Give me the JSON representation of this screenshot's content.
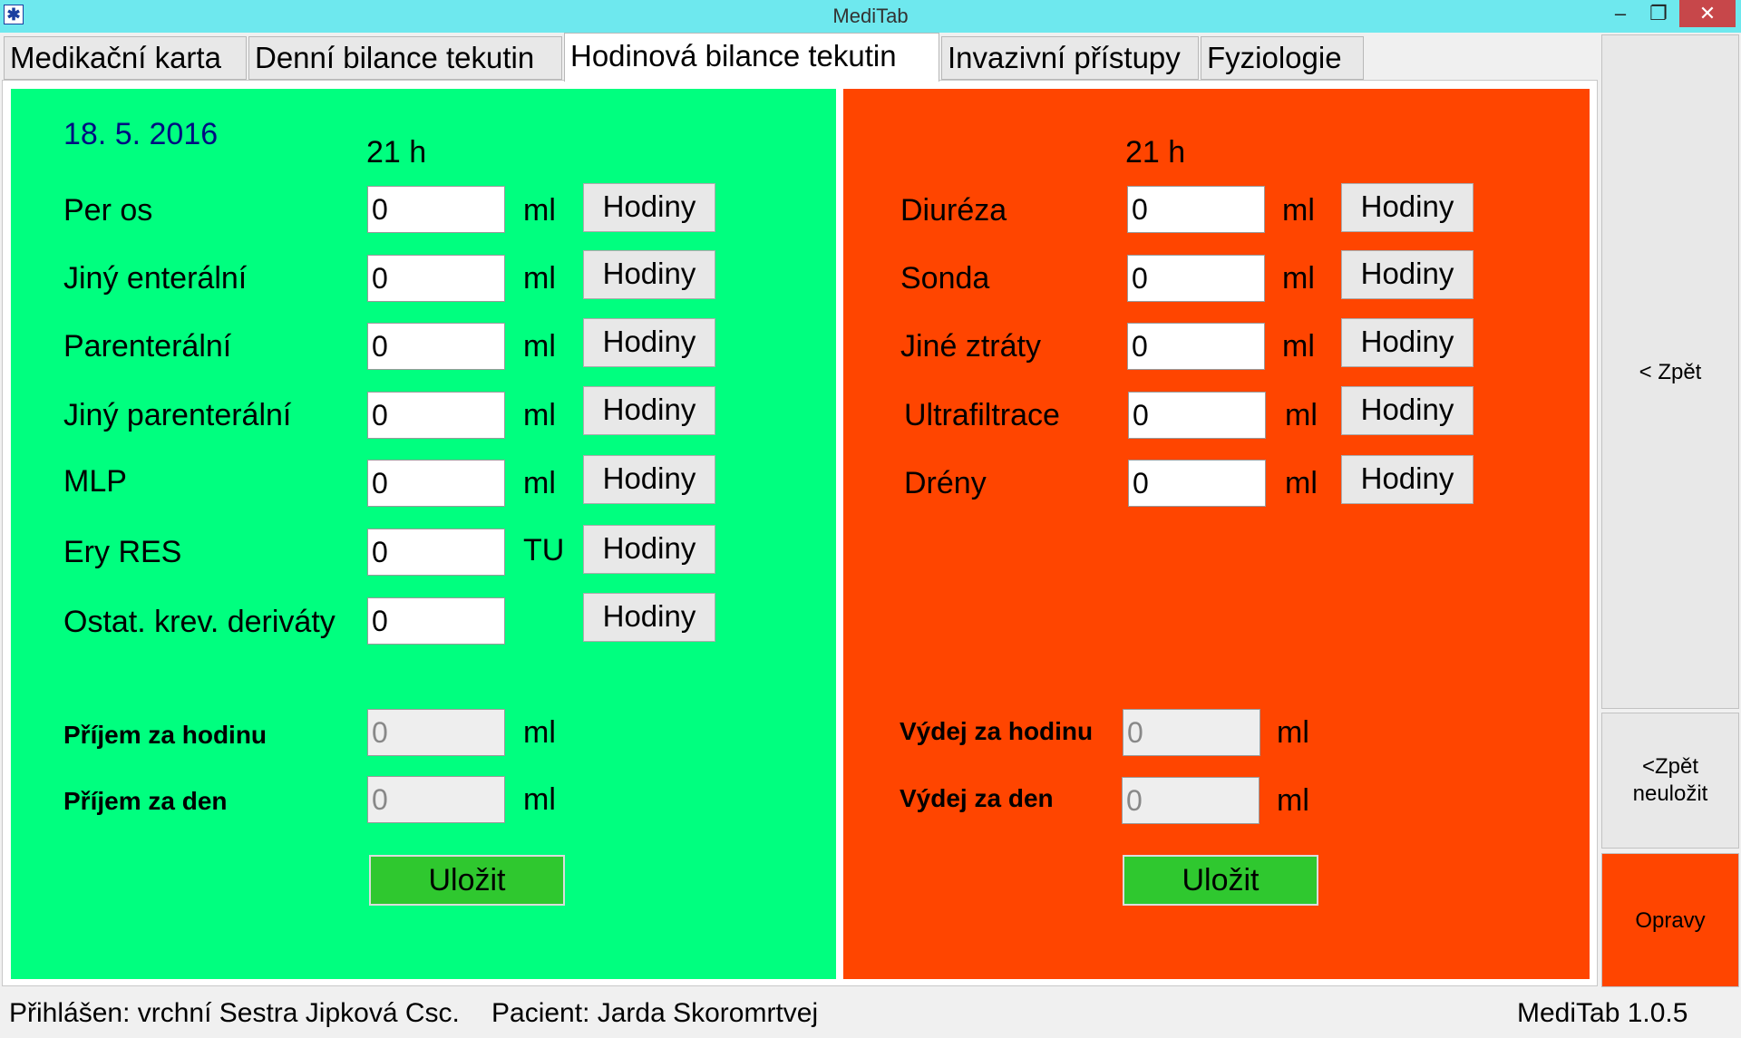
{
  "window": {
    "title": "MediTab",
    "min": "–",
    "max": "❐",
    "close": "✕"
  },
  "tabs": [
    {
      "label": "Medikační karta"
    },
    {
      "label": "Denní bilance tekutin"
    },
    {
      "label": "Hodinová bilance tekutin"
    },
    {
      "label": "Invazivní přístupy"
    },
    {
      "label": "Fyziologie"
    }
  ],
  "intake": {
    "date": "18. 5. 2016",
    "hour": "21 h",
    "rows": [
      {
        "label": "Per os",
        "value": "0",
        "unit": "ml",
        "button": "Hodiny"
      },
      {
        "label": "Jiný enterální",
        "value": "0",
        "unit": "ml",
        "button": "Hodiny"
      },
      {
        "label": "Parenterální",
        "value": "0",
        "unit": "ml",
        "button": "Hodiny"
      },
      {
        "label": "Jiný parenterální",
        "value": "0",
        "unit": "ml",
        "button": "Hodiny"
      },
      {
        "label": "MLP",
        "value": "0",
        "unit": "ml",
        "button": "Hodiny"
      },
      {
        "label": "Ery RES",
        "value": "0",
        "unit": "TU",
        "button": "Hodiny"
      },
      {
        "label": "Ostat. krev. deriváty",
        "value": "0",
        "unit": "",
        "button": "Hodiny"
      }
    ],
    "total_hour": {
      "label": "Příjem za hodinu",
      "value": "0",
      "unit": "ml"
    },
    "total_day": {
      "label": "Příjem za den",
      "value": "0",
      "unit": "ml"
    },
    "save_label": "Uložit"
  },
  "output": {
    "hour": "21 h",
    "rows": [
      {
        "label": "Diuréza",
        "value": "0",
        "unit": "ml",
        "button": "Hodiny"
      },
      {
        "label": "Sonda",
        "value": "0",
        "unit": "ml",
        "button": "Hodiny"
      },
      {
        "label": "Jiné ztráty",
        "value": "0",
        "unit": "ml",
        "button": "Hodiny"
      },
      {
        "label": "Ultrafiltrace",
        "value": "0",
        "unit": "ml",
        "button": "Hodiny"
      },
      {
        "label": "Drény",
        "value": "0",
        "unit": "ml",
        "button": "Hodiny"
      }
    ],
    "total_hour": {
      "label": "Výdej za hodinu",
      "value": "0",
      "unit": "ml"
    },
    "total_day": {
      "label": "Výdej za den",
      "value": "0",
      "unit": "ml"
    },
    "save_label": "Uložit"
  },
  "sidebar": {
    "back": "< Zpět",
    "back_nosave_line1": "<Zpět",
    "back_nosave_line2": "neuložit",
    "fixes": "Opravy"
  },
  "status": {
    "user": "Přihlášen: vrchní Sestra Jipková Csc.",
    "patient": "Pacient: Jarda Skoromrtvej",
    "version": "MediTab 1.0.5"
  },
  "colors": {
    "intake_panel": "#00ff7f",
    "output_panel": "#ff4500",
    "save_button": "#2fc82f",
    "titlebar": "#6ee8ee"
  }
}
